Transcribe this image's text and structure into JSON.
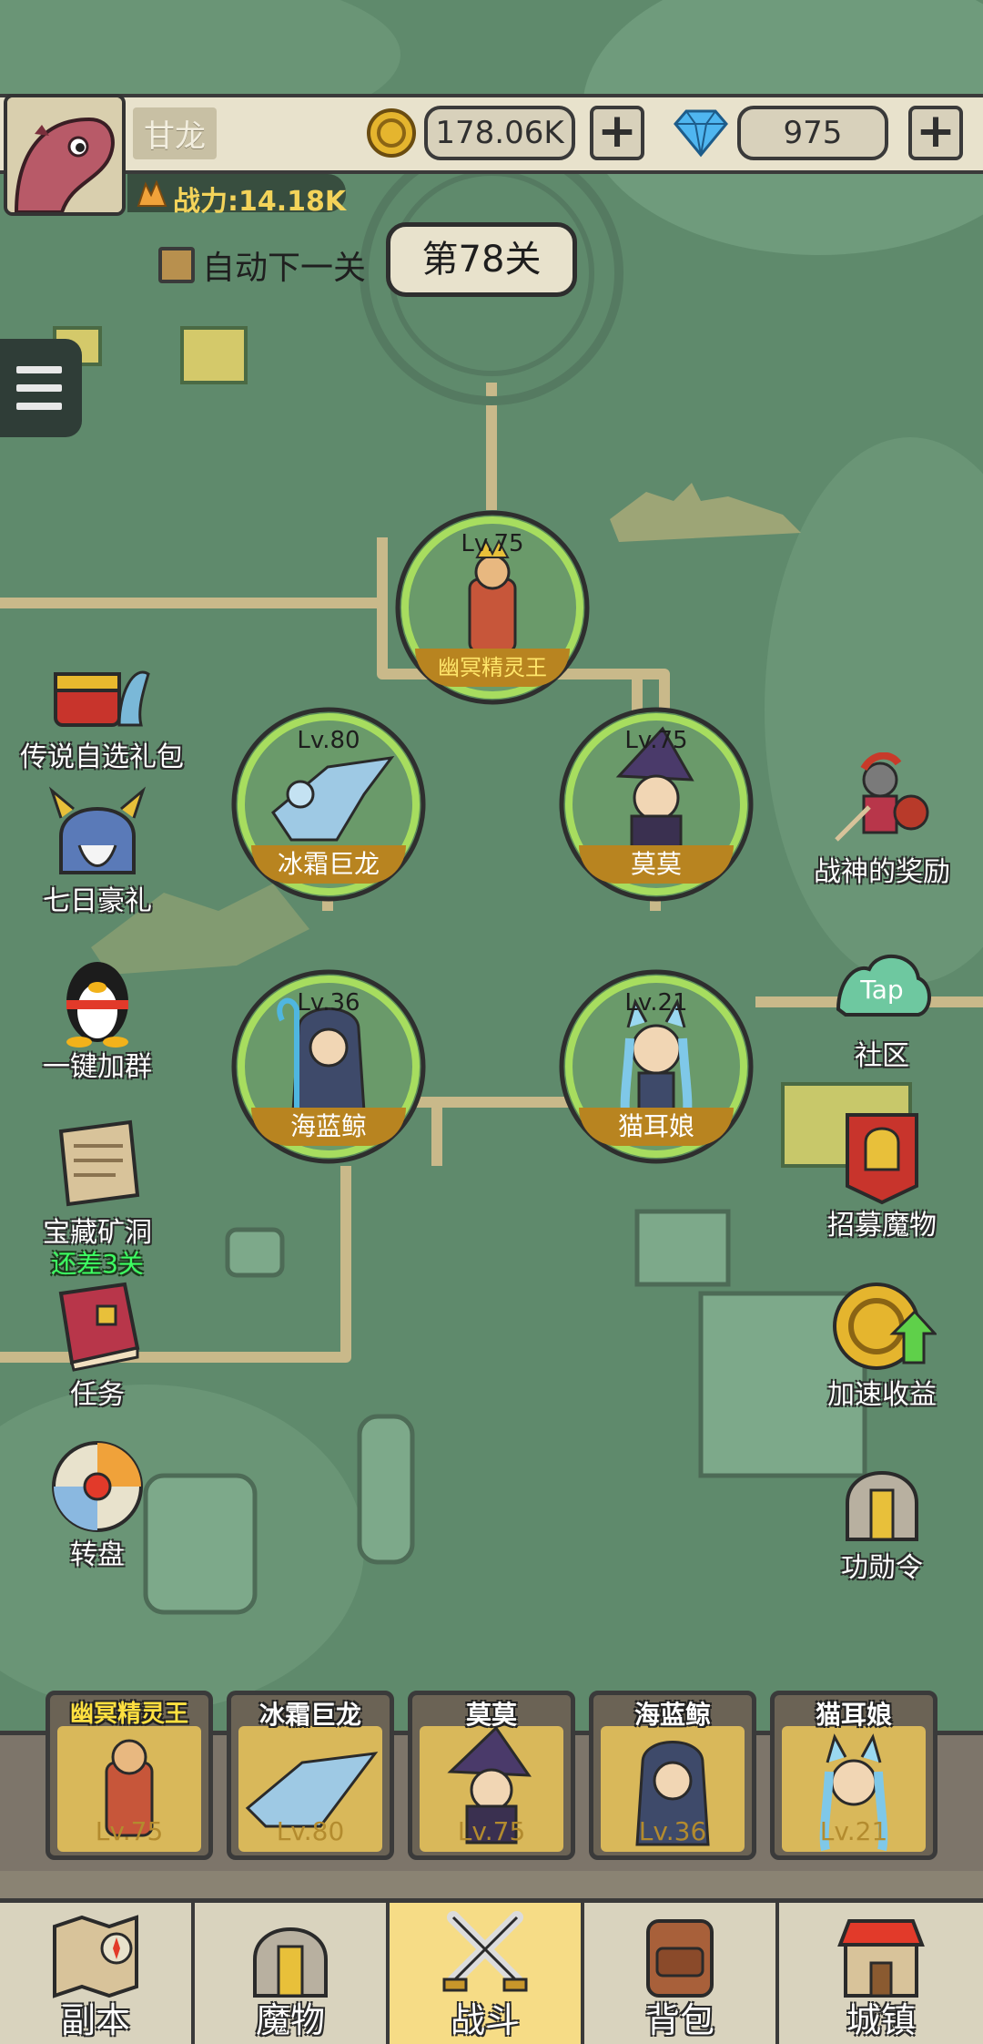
{
  "player": {
    "name": "甘龙",
    "power": "战力:14.18K",
    "gold": "178.06K",
    "diamonds": "975"
  },
  "stage": {
    "auto_next_label": "自动下一关",
    "current": "第78关"
  },
  "team_nodes": [
    {
      "level": "Lv.75",
      "name": "幽冥精灵王"
    },
    {
      "level": "Lv.80",
      "name": "冰霜巨龙"
    },
    {
      "level": "Lv.75",
      "name": "莫莫"
    },
    {
      "level": "Lv.36",
      "name": "海蓝鲸"
    },
    {
      "level": "Lv.21",
      "name": "猫耳娘"
    }
  ],
  "left_menu": [
    {
      "label": "传说自选礼包"
    },
    {
      "label": "七日豪礼"
    },
    {
      "label": "一键加群"
    },
    {
      "label": "宝藏矿洞",
      "sub": "还差3关"
    },
    {
      "label": "任务"
    },
    {
      "label": "转盘"
    }
  ],
  "right_menu": [
    {
      "label": "战神的奖励"
    },
    {
      "label": "社区",
      "icon_text": "Tap"
    },
    {
      "label": "招募魔物"
    },
    {
      "label": "加速收益"
    },
    {
      "label": "功勋令"
    }
  ],
  "team_bar": [
    {
      "name": "幽冥精灵王",
      "level": "Lv.75"
    },
    {
      "name": "冰霜巨龙",
      "level": "Lv.80"
    },
    {
      "name": "莫莫",
      "level": "Lv.75"
    },
    {
      "name": "海蓝鲸",
      "level": "Lv.36"
    },
    {
      "name": "猫耳娘",
      "level": "Lv.21"
    }
  ],
  "nav": [
    {
      "label": "副本"
    },
    {
      "label": "魔物"
    },
    {
      "label": "战斗",
      "active": true
    },
    {
      "label": "背包"
    },
    {
      "label": "城镇"
    }
  ],
  "colors": {
    "ground": "#5f8a6c",
    "path": "#c9b98a",
    "node_ring": "#9ed35a",
    "name_band": "#b88420",
    "active_tab": "#f6dc86"
  }
}
